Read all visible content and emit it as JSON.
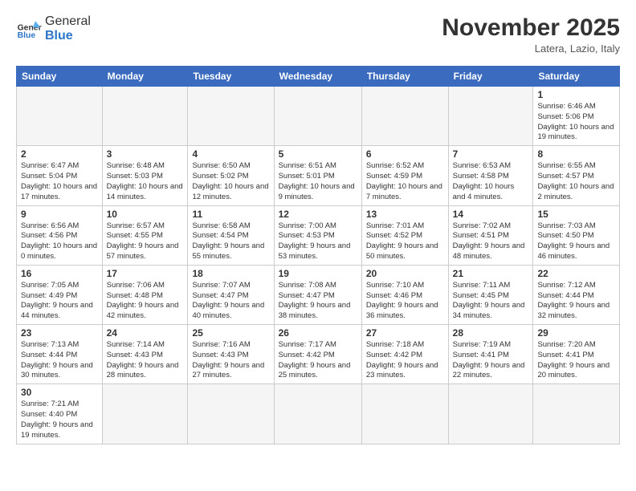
{
  "header": {
    "logo_general": "General",
    "logo_blue": "Blue",
    "month_title": "November 2025",
    "subtitle": "Latera, Lazio, Italy"
  },
  "days_of_week": [
    "Sunday",
    "Monday",
    "Tuesday",
    "Wednesday",
    "Thursday",
    "Friday",
    "Saturday"
  ],
  "weeks": [
    [
      {
        "num": "",
        "info": ""
      },
      {
        "num": "",
        "info": ""
      },
      {
        "num": "",
        "info": ""
      },
      {
        "num": "",
        "info": ""
      },
      {
        "num": "",
        "info": ""
      },
      {
        "num": "",
        "info": ""
      },
      {
        "num": "1",
        "info": "Sunrise: 6:46 AM\nSunset: 5:06 PM\nDaylight: 10 hours and 19 minutes."
      }
    ],
    [
      {
        "num": "2",
        "info": "Sunrise: 6:47 AM\nSunset: 5:04 PM\nDaylight: 10 hours and 17 minutes."
      },
      {
        "num": "3",
        "info": "Sunrise: 6:48 AM\nSunset: 5:03 PM\nDaylight: 10 hours and 14 minutes."
      },
      {
        "num": "4",
        "info": "Sunrise: 6:50 AM\nSunset: 5:02 PM\nDaylight: 10 hours and 12 minutes."
      },
      {
        "num": "5",
        "info": "Sunrise: 6:51 AM\nSunset: 5:01 PM\nDaylight: 10 hours and 9 minutes."
      },
      {
        "num": "6",
        "info": "Sunrise: 6:52 AM\nSunset: 4:59 PM\nDaylight: 10 hours and 7 minutes."
      },
      {
        "num": "7",
        "info": "Sunrise: 6:53 AM\nSunset: 4:58 PM\nDaylight: 10 hours and 4 minutes."
      },
      {
        "num": "8",
        "info": "Sunrise: 6:55 AM\nSunset: 4:57 PM\nDaylight: 10 hours and 2 minutes."
      }
    ],
    [
      {
        "num": "9",
        "info": "Sunrise: 6:56 AM\nSunset: 4:56 PM\nDaylight: 10 hours and 0 minutes."
      },
      {
        "num": "10",
        "info": "Sunrise: 6:57 AM\nSunset: 4:55 PM\nDaylight: 9 hours and 57 minutes."
      },
      {
        "num": "11",
        "info": "Sunrise: 6:58 AM\nSunset: 4:54 PM\nDaylight: 9 hours and 55 minutes."
      },
      {
        "num": "12",
        "info": "Sunrise: 7:00 AM\nSunset: 4:53 PM\nDaylight: 9 hours and 53 minutes."
      },
      {
        "num": "13",
        "info": "Sunrise: 7:01 AM\nSunset: 4:52 PM\nDaylight: 9 hours and 50 minutes."
      },
      {
        "num": "14",
        "info": "Sunrise: 7:02 AM\nSunset: 4:51 PM\nDaylight: 9 hours and 48 minutes."
      },
      {
        "num": "15",
        "info": "Sunrise: 7:03 AM\nSunset: 4:50 PM\nDaylight: 9 hours and 46 minutes."
      }
    ],
    [
      {
        "num": "16",
        "info": "Sunrise: 7:05 AM\nSunset: 4:49 PM\nDaylight: 9 hours and 44 minutes."
      },
      {
        "num": "17",
        "info": "Sunrise: 7:06 AM\nSunset: 4:48 PM\nDaylight: 9 hours and 42 minutes."
      },
      {
        "num": "18",
        "info": "Sunrise: 7:07 AM\nSunset: 4:47 PM\nDaylight: 9 hours and 40 minutes."
      },
      {
        "num": "19",
        "info": "Sunrise: 7:08 AM\nSunset: 4:47 PM\nDaylight: 9 hours and 38 minutes."
      },
      {
        "num": "20",
        "info": "Sunrise: 7:10 AM\nSunset: 4:46 PM\nDaylight: 9 hours and 36 minutes."
      },
      {
        "num": "21",
        "info": "Sunrise: 7:11 AM\nSunset: 4:45 PM\nDaylight: 9 hours and 34 minutes."
      },
      {
        "num": "22",
        "info": "Sunrise: 7:12 AM\nSunset: 4:44 PM\nDaylight: 9 hours and 32 minutes."
      }
    ],
    [
      {
        "num": "23",
        "info": "Sunrise: 7:13 AM\nSunset: 4:44 PM\nDaylight: 9 hours and 30 minutes."
      },
      {
        "num": "24",
        "info": "Sunrise: 7:14 AM\nSunset: 4:43 PM\nDaylight: 9 hours and 28 minutes."
      },
      {
        "num": "25",
        "info": "Sunrise: 7:16 AM\nSunset: 4:43 PM\nDaylight: 9 hours and 27 minutes."
      },
      {
        "num": "26",
        "info": "Sunrise: 7:17 AM\nSunset: 4:42 PM\nDaylight: 9 hours and 25 minutes."
      },
      {
        "num": "27",
        "info": "Sunrise: 7:18 AM\nSunset: 4:42 PM\nDaylight: 9 hours and 23 minutes."
      },
      {
        "num": "28",
        "info": "Sunrise: 7:19 AM\nSunset: 4:41 PM\nDaylight: 9 hours and 22 minutes."
      },
      {
        "num": "29",
        "info": "Sunrise: 7:20 AM\nSunset: 4:41 PM\nDaylight: 9 hours and 20 minutes."
      }
    ],
    [
      {
        "num": "30",
        "info": "Sunrise: 7:21 AM\nSunset: 4:40 PM\nDaylight: 9 hours and 19 minutes."
      },
      {
        "num": "",
        "info": ""
      },
      {
        "num": "",
        "info": ""
      },
      {
        "num": "",
        "info": ""
      },
      {
        "num": "",
        "info": ""
      },
      {
        "num": "",
        "info": ""
      },
      {
        "num": "",
        "info": ""
      }
    ]
  ]
}
